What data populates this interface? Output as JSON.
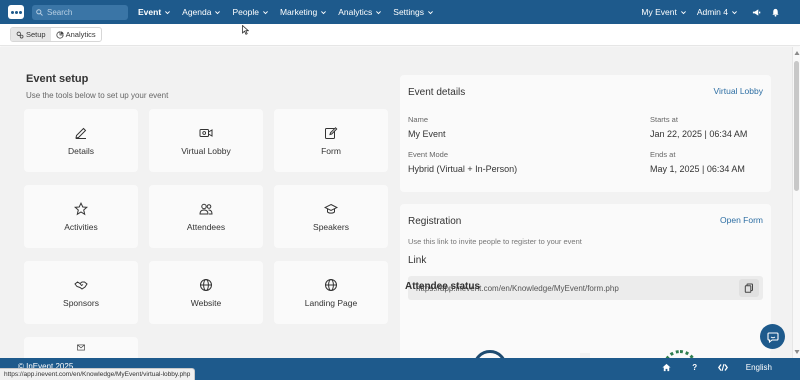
{
  "topbar": {
    "search_placeholder": "Search",
    "nav": [
      {
        "label": "Event"
      },
      {
        "label": "Agenda"
      },
      {
        "label": "People"
      },
      {
        "label": "Marketing"
      },
      {
        "label": "Analytics"
      },
      {
        "label": "Settings"
      }
    ],
    "event_select": "My Event",
    "admin_select": "Admin 4"
  },
  "subbar": {
    "tabs": [
      {
        "label": "Setup",
        "icon": "settings-icon",
        "selected": true
      },
      {
        "label": "Analytics",
        "icon": "chart-icon",
        "selected": false
      }
    ]
  },
  "setup": {
    "title": "Event setup",
    "subtitle": "Use the tools below to set up your event",
    "tiles": [
      {
        "label": "Details",
        "icon": "pencil-icon"
      },
      {
        "label": "Virtual Lobby",
        "icon": "video-icon"
      },
      {
        "label": "Form",
        "icon": "edit-icon"
      },
      {
        "label": "Activities",
        "icon": "star-icon"
      },
      {
        "label": "Attendees",
        "icon": "users-icon"
      },
      {
        "label": "Speakers",
        "icon": "graduation-cap-icon"
      },
      {
        "label": "Sponsors",
        "icon": "handshake-icon"
      },
      {
        "label": "Website",
        "icon": "globe-icon"
      },
      {
        "label": "Landing Page",
        "icon": "globe-icon"
      },
      {
        "label": "",
        "icon": "mail-icon"
      }
    ]
  },
  "details": {
    "title": "Event details",
    "link": "Virtual Lobby",
    "name_label": "Name",
    "name_value": "My Event",
    "starts_label": "Starts at",
    "starts_value": "Jan 22, 2025 | 06:34 AM",
    "mode_label": "Event Mode",
    "mode_value": "Hybrid (Virtual + In-Person)",
    "ends_label": "Ends at",
    "ends_value": "May 1, 2025 | 06:34 AM"
  },
  "registration": {
    "title": "Registration",
    "link": "Open Form",
    "note": "Use this link to invite people to register to your event",
    "link_label": "Link",
    "url": "https://app.inevent.com/en/Knowledge/MyEvent/form.php"
  },
  "attendee_status": {
    "title": "Attendee status"
  },
  "footer": {
    "copyright": "© InEvent 2025",
    "language": "English",
    "status_url": "https://app.inevent.com/en/Knowledge/MyEvent/virtual-lobby.php"
  }
}
